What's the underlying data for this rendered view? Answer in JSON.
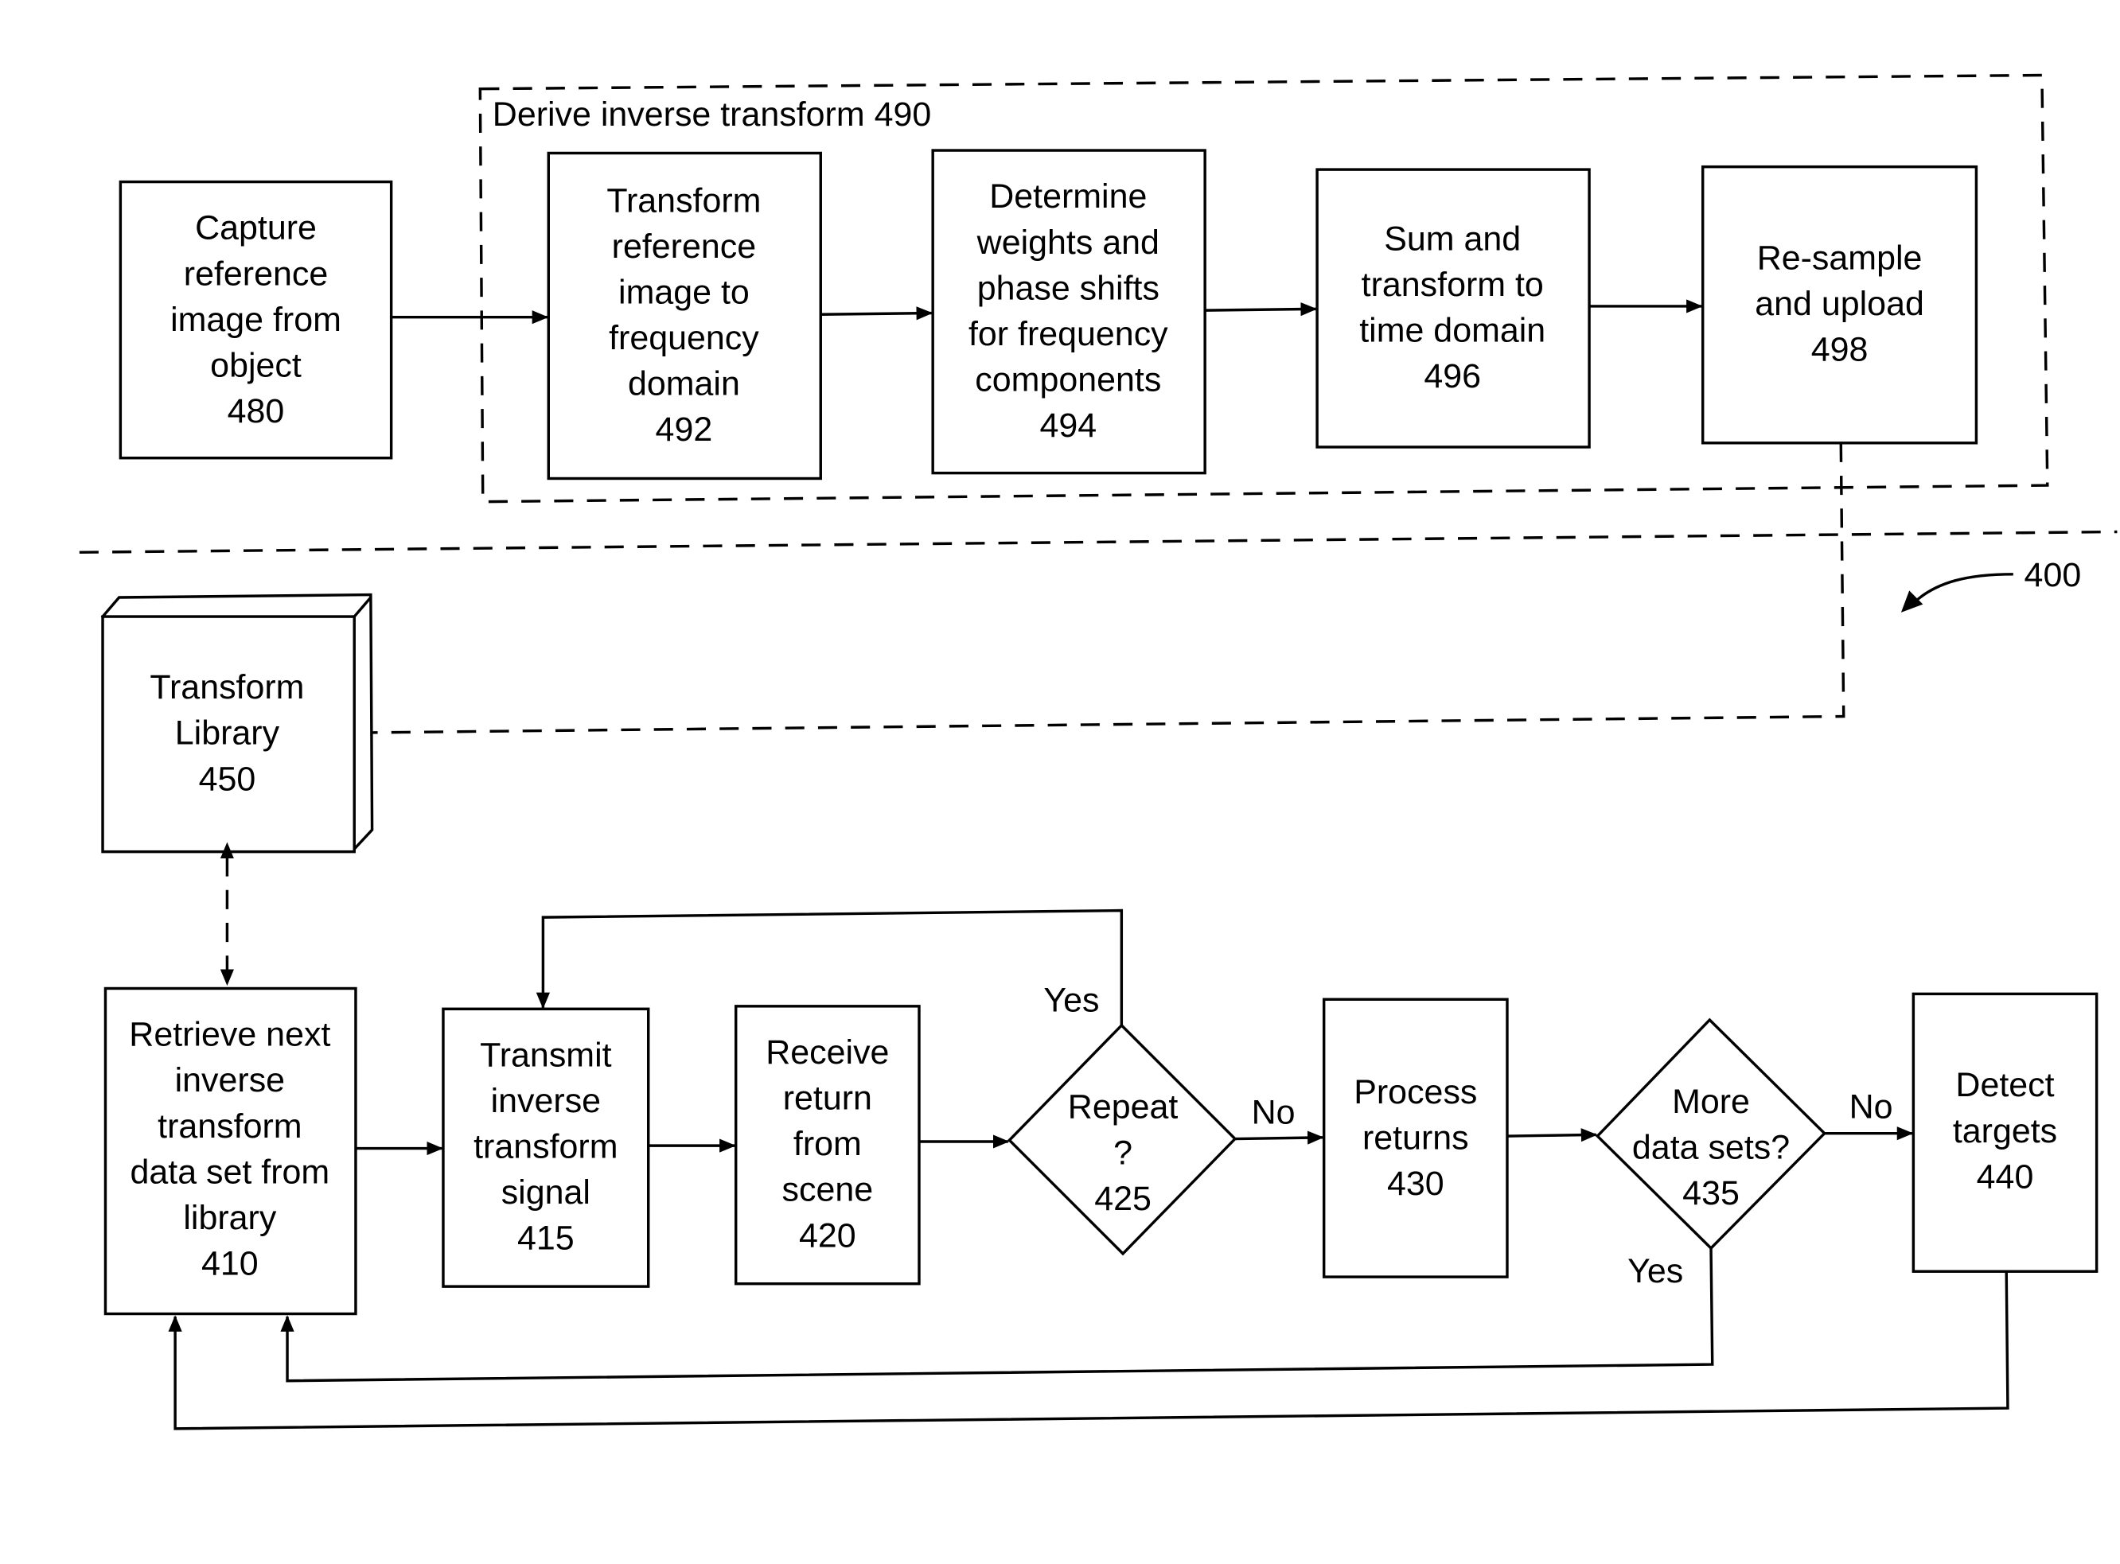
{
  "figure_ref": "400",
  "derive_group": {
    "label": "Derive inverse transform 490"
  },
  "blocks": {
    "b480": {
      "lines": [
        "Capture",
        "reference",
        "image from",
        "object",
        "480"
      ]
    },
    "b492": {
      "lines": [
        "Transform",
        "reference",
        "image to",
        "frequency",
        "domain",
        "492"
      ]
    },
    "b494": {
      "lines": [
        "Determine",
        "weights and",
        "phase shifts",
        "for frequency",
        "components",
        "494"
      ]
    },
    "b496": {
      "lines": [
        "Sum and",
        "transform to",
        "time domain",
        "496"
      ]
    },
    "b498": {
      "lines": [
        "Re-sample",
        "and upload",
        "498"
      ]
    },
    "b450": {
      "lines": [
        "Transform",
        "Library",
        "450"
      ]
    },
    "b410": {
      "lines": [
        "Retrieve next",
        "inverse",
        "transform",
        "data set from",
        "library",
        "410"
      ]
    },
    "b415": {
      "lines": [
        "Transmit",
        "inverse",
        "transform",
        "signal",
        "415"
      ]
    },
    "b420": {
      "lines": [
        "Receive",
        "return",
        "from",
        "scene",
        "420"
      ]
    },
    "d425": {
      "lines": [
        "Repeat",
        "?",
        "425"
      ]
    },
    "b430": {
      "lines": [
        "Process",
        "returns",
        "430"
      ]
    },
    "d435": {
      "lines": [
        "More",
        "data sets?",
        "435"
      ]
    },
    "b440": {
      "lines": [
        "Detect",
        "targets",
        "440"
      ]
    }
  },
  "edge_labels": {
    "repeat_yes": "Yes",
    "repeat_no": "No",
    "more_no": "No",
    "more_yes": "Yes"
  }
}
